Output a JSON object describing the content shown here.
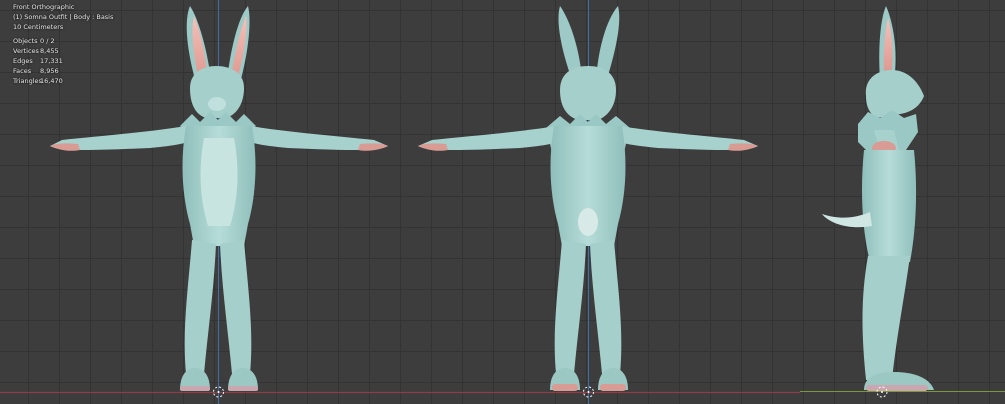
{
  "viewport": {
    "view_name": "Front Orthographic",
    "object_info": "(1) Somna Outfit | Body : Basis",
    "grid_scale": "10 Centimeters",
    "stats": [
      {
        "label": "Objects",
        "value": "0 / 2"
      },
      {
        "label": "Vertices",
        "value": "8,455"
      },
      {
        "label": "Edges",
        "value": "17,331"
      },
      {
        "label": "Faces",
        "value": "8,956"
      },
      {
        "label": "Triangles",
        "value": "16,470"
      }
    ]
  },
  "colors": {
    "background": "#3d3d3d",
    "grid": "#333333",
    "model": "#a9d3cf",
    "ear_inner": "#e0a19b",
    "paw_pads": "#d99c95",
    "x_axis": "#8f3c45",
    "y_axis": "#7a9a3a",
    "z_axis": "#3f6fa8"
  },
  "views": [
    "front-view",
    "back-view",
    "side-view"
  ]
}
